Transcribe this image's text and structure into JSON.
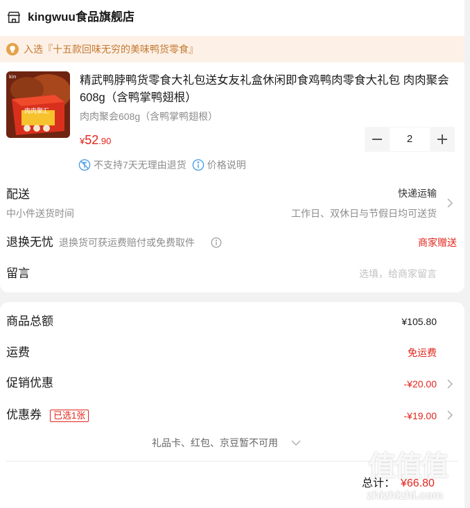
{
  "store": {
    "name": "kingwuu食品旗舰店",
    "icon": "store-icon"
  },
  "promo": {
    "text": "入选『十五款回味无穷的美味鸭货零食』",
    "icon": "lightbulb-icon"
  },
  "product": {
    "title": "精武鸭脖鸭货零食大礼包送女友礼盒休闲即食鸡鸭肉零食大礼包 肉肉聚会608g（含鸭掌鸭翅根）",
    "spec": "肉肉聚会608g（含鸭掌鸭翅根）",
    "price_currency": "¥",
    "price_integer": "52",
    "price_decimal": ".90",
    "quantity": "2",
    "tag_return": "不支持7天无理由退货",
    "tag_price_info": "价格说明",
    "thumb_box_text": "肉肉聚汇"
  },
  "delivery": {
    "label": "配送",
    "sub": "中小件送货时间",
    "method": "快递运输",
    "detail": "工作日、双休日与节假日均可送货"
  },
  "return_service": {
    "label": "退换无忧",
    "sub": "退换货可获运费赔付或免费取件",
    "value": "商家赠送"
  },
  "message": {
    "label": "留言",
    "placeholder": "选填，给商家留言"
  },
  "summary": {
    "subtotal_label": "商品总额",
    "subtotal_value": "¥105.80",
    "shipping_label": "运费",
    "shipping_value": "免运费",
    "promotion_label": "促销优惠",
    "promotion_value": "-¥20.00",
    "coupon_label": "优惠券",
    "coupon_badge": "已选1张",
    "coupon_value": "-¥19.00",
    "unavailable": "礼品卡、红包、京豆暂不可用",
    "total_label": "总计：",
    "total_value": "¥66.80"
  },
  "watermark": {
    "logo": "值值值",
    "site": "zhizhizhi.com"
  },
  "colors": {
    "accent_red": "#e1251b",
    "promo_bg": "#fdf1e7",
    "promo_text": "#c4782f",
    "icon_blue": "#4c9ee8"
  }
}
